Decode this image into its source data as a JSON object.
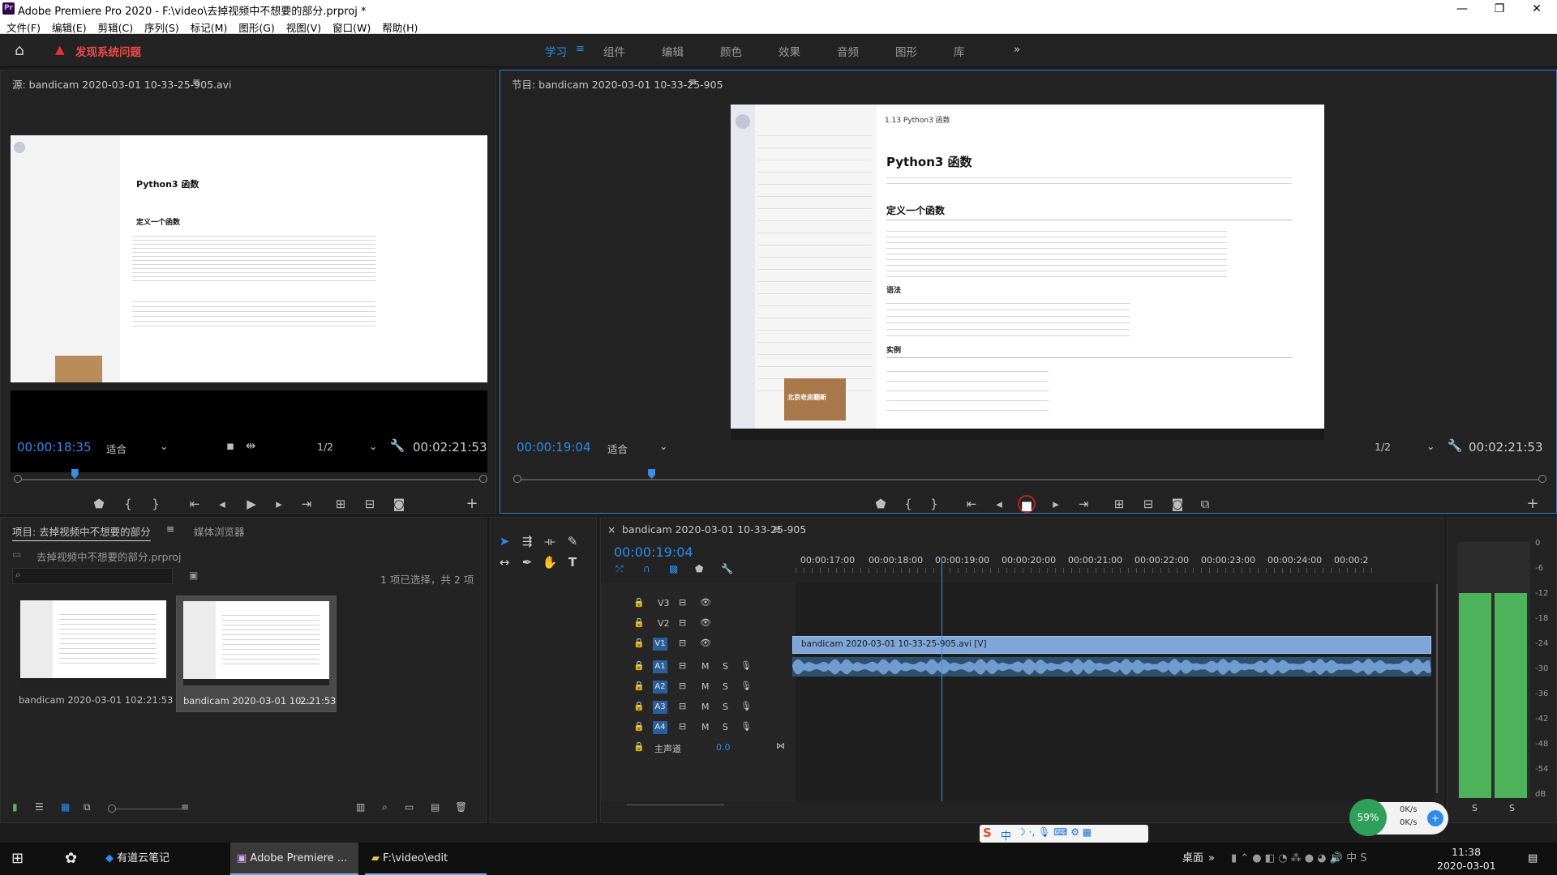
{
  "window": {
    "title": "Adobe Premiere Pro 2020 - F:\\video\\去掉视频中不想要的部分.prproj *",
    "logo": "Pr"
  },
  "menu": [
    "文件(F)",
    "编辑(E)",
    "剪辑(C)",
    "序列(S)",
    "标记(M)",
    "图形(G)",
    "视图(V)",
    "窗口(W)",
    "帮助(H)"
  ],
  "workspace": {
    "alert": "发现系统问题",
    "tabs": [
      "学习",
      "组件",
      "编辑",
      "颜色",
      "效果",
      "音频",
      "图形",
      "库"
    ],
    "active": "学习",
    "more": "»"
  },
  "source": {
    "title": "源: bandicam 2020-03-01 10-33-25-905.avi",
    "timecode": "00:00:18:35",
    "fit": "适合",
    "res": "1/2",
    "duration": "00:02:21:53",
    "playhead_fraction": 0.12
  },
  "program": {
    "title": "节目: bandicam 2020-03-01 10-33-25-905",
    "timecode": "00:00:19:04",
    "fit": "适合",
    "res": "1/2",
    "duration": "00:02:21:53",
    "playhead_fraction": 0.13
  },
  "doc": {
    "heading": "1.13 Python3 函数",
    "h1": "Python3 函数",
    "h2a": "定义一个函数",
    "h2b": "语法",
    "h2c": "实例",
    "book": "北京老房翻新"
  },
  "project": {
    "tab1": "项目: 去掉视频中不想要的部分",
    "tab2": "媒体浏览器",
    "file": "去掉视频中不想要的部分.prproj",
    "selection": "1 项已选择，共 2 项",
    "items": [
      {
        "name": "bandicam 2020-03-01 10-...",
        "dur": "2:21:53"
      },
      {
        "name": "bandicam 2020-03-01 10-...",
        "dur": "2:21:53"
      }
    ]
  },
  "timeline": {
    "tab": "bandicam 2020-03-01 10-33-25-905",
    "timecode": "00:00:19:04",
    "ruler": [
      "00:00:17:00",
      "00:00:18:00",
      "00:00:19:00",
      "00:00:20:00",
      "00:00:21:00",
      "00:00:22:00",
      "00:00:23:00",
      "00:00:24:00",
      "00:00:2"
    ],
    "video_tracks": [
      "V3",
      "V2",
      "V1"
    ],
    "audio_tracks": [
      "A1",
      "A2",
      "A3",
      "A4"
    ],
    "master_label": "主声道",
    "master_val": "0.0",
    "clip": "bandicam 2020-03-01 10-33-25-905.avi [V]"
  },
  "meter": {
    "scale": [
      "0",
      "-6",
      "-12",
      "-18",
      "-24",
      "-30",
      "-36",
      "-42",
      "-48",
      "-54",
      "dB"
    ],
    "solo": [
      "S",
      "S"
    ],
    "level_fraction": 0.8
  },
  "netwidget": {
    "pct": "59%",
    "up": "0K/s",
    "down": "0K/s"
  },
  "taskbar": {
    "items": [
      "有道云笔记",
      "Adobe Premiere ...",
      "F:\\video\\edit"
    ],
    "desktop": "桌面",
    "time": "11:38",
    "date": "2020-03-01",
    "ime": "中"
  }
}
